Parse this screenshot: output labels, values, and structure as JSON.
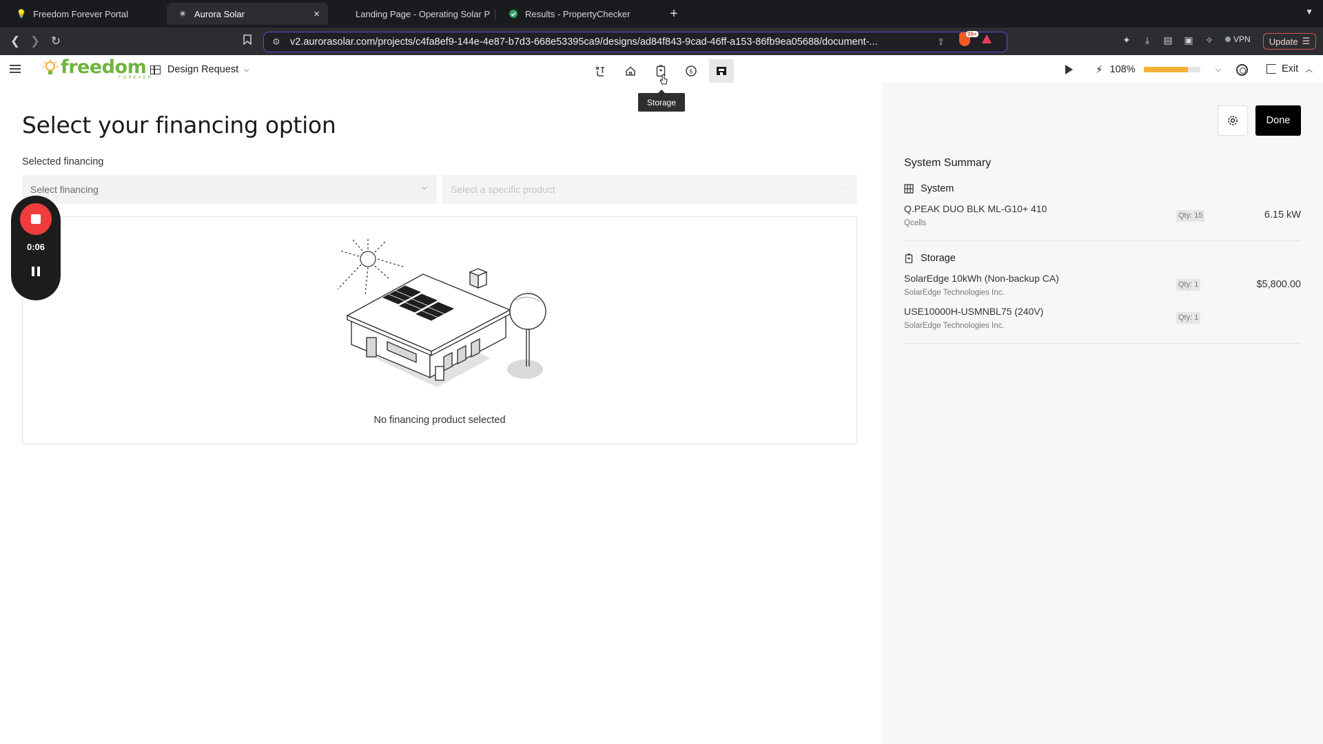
{
  "browser": {
    "tabs": [
      {
        "title": "Freedom Forever Portal"
      },
      {
        "title": "Aurora Solar",
        "close": "×"
      },
      {
        "title": "Landing Page - Operating Solar P"
      },
      {
        "title": "Results - PropertyChecker"
      }
    ],
    "new_tab": "+",
    "url": "v2.aurorasolar.com/projects/c4fa8ef9-144e-4e87-b7d3-668e53395ca9/designs/ad84f843-9cad-46ff-a153-86fb9ea05688/document-...",
    "brave_badge": "99+",
    "vpn_label": "VPN",
    "update_label": "Update"
  },
  "app": {
    "logo_text": "freedom",
    "logo_sub": "FOREVER",
    "design_request_label": "Design Request",
    "tooltip": "Storage",
    "zoom_label": "108%",
    "zoom_fraction": 0.78,
    "exit_label": "Exit"
  },
  "main": {
    "title": "Select your financing option",
    "selected_financing_label": "Selected financing",
    "financing_placeholder": "Select financing",
    "product_placeholder": "Select a specific product",
    "empty_message": "No financing product selected"
  },
  "recorder": {
    "time": "0:06"
  },
  "summary": {
    "done_label": "Done",
    "title": "System Summary",
    "sections": [
      {
        "name": "System",
        "items": [
          {
            "name": "Q.PEAK DUO BLK ML-G10+ 410",
            "manufacturer": "Qcells",
            "qty": "Qty: 15",
            "value": "6.15 kW"
          }
        ]
      },
      {
        "name": "Storage",
        "items": [
          {
            "name": "SolarEdge 10kWh (Non-backup CA)",
            "manufacturer": "SolarEdge Technologies Inc.",
            "qty": "Qty: 1",
            "value": "$5,800.00"
          },
          {
            "name": "USE10000H-USMNBL75 (240V)",
            "manufacturer": "SolarEdge Technologies Inc.",
            "qty": "Qty: 1",
            "value": ""
          }
        ]
      }
    ]
  },
  "colors": {
    "brand_green": "#6fb43f",
    "zoom_fill": "#f2b233",
    "record_red": "#f03c3c",
    "done_black": "#000000"
  }
}
